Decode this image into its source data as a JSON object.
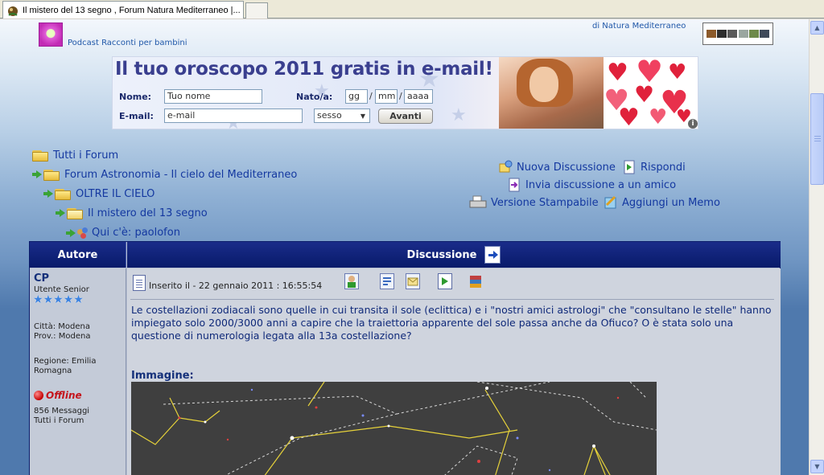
{
  "browser": {
    "tab_title": "Il mistero del 13 segno , Forum Natura Mediterraneo |..."
  },
  "header": {
    "podcast_link": "Podcast Racconti per bambini",
    "natura_link": "di Natura Mediterraneo"
  },
  "ad": {
    "title": "Il tuo oroscopo 2011 gratis in e-mail!",
    "name_label": "Nome:",
    "name_value": "Tuo nome",
    "birth_label": "Nato/a:",
    "day_value": "gg",
    "month_value": "mm",
    "year_value": "aaaa",
    "email_label": "E-mail:",
    "email_value": "e-mail",
    "sex_value": "sesso",
    "submit_label": "Avanti",
    "info_glyph": "i"
  },
  "breadcrumb": {
    "all_forums": "Tutti i Forum",
    "forum": "Forum Astronomia - Il cielo del Mediterraneo",
    "subforum": "OLTRE IL CIELO",
    "topic": "Il mistero del 13 segno",
    "who_here": "Qui c'è: paolofon"
  },
  "actions": {
    "new_topic": "Nuova Discussione",
    "reply": "Rispondi",
    "send_friend": "Invia discussione a un amico",
    "print_version": "Versione Stampabile",
    "add_memo": "Aggiungi un Memo"
  },
  "table": {
    "author_header": "Autore",
    "topic_header": "Discussione"
  },
  "author": {
    "name": "CP",
    "rank": "Utente Senior",
    "stars": [
      "★",
      "★",
      "★",
      "★",
      "★"
    ],
    "city": "Città: Modena",
    "province": "Prov.: Modena",
    "region_line1": "Regione: Emilia",
    "region_line2": "Romagna",
    "status": "Offline",
    "messages": "856 Messaggi",
    "all_forums": "Tutti i Forum"
  },
  "post": {
    "meta": "Inserito il - 22 gennaio 2011 : 16:55:54",
    "body": "Le costellazioni zodiacali sono quelle in cui transita il sole (eclittica) e i \"nostri amici astrologi\" che \"consultano le stelle\" hanno impiegato solo 2000/3000 anni a capire che la traiettoria apparente del sole passa anche da Ofiuco? O è stata solo una questione di numerologia legata alla 13a costellazione?",
    "image_label": "Immagine:"
  },
  "colors": {
    "link": "#1438a0",
    "header_bg": "#0f2278",
    "offline": "#c4141c"
  }
}
